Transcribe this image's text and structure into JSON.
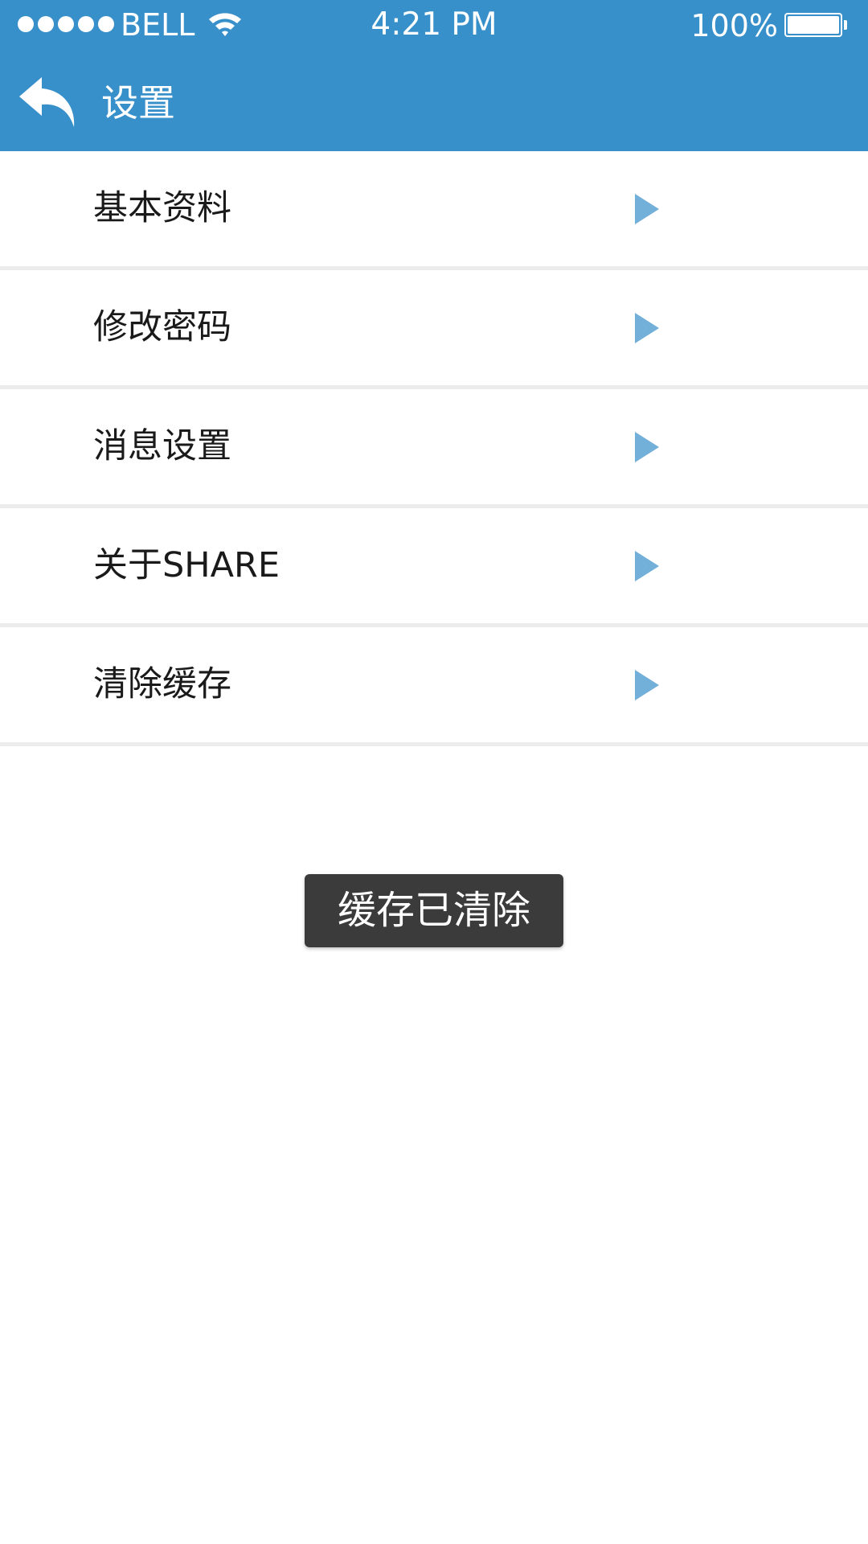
{
  "status_bar": {
    "carrier": "BELL",
    "time": "4:21 PM",
    "battery": "100%",
    "battery_level": 1.0,
    "signal_icon": "signal-dots-icon",
    "wifi_icon": "wifi-icon",
    "battery_icon": "battery-icon"
  },
  "nav_bar": {
    "back_icon": "reply-arrow-icon",
    "title": "设置",
    "color": "#3890cb"
  },
  "menu": {
    "items": [
      {
        "label": "基本资料"
      },
      {
        "label": "修改密码"
      },
      {
        "label": "消息设置"
      },
      {
        "label": "关于SHARE"
      },
      {
        "label": "清除缓存"
      }
    ],
    "arrow_icon": "play-triangle-icon",
    "arrow_color": "#72afd9"
  },
  "toast": {
    "message": "缓存已清除"
  }
}
